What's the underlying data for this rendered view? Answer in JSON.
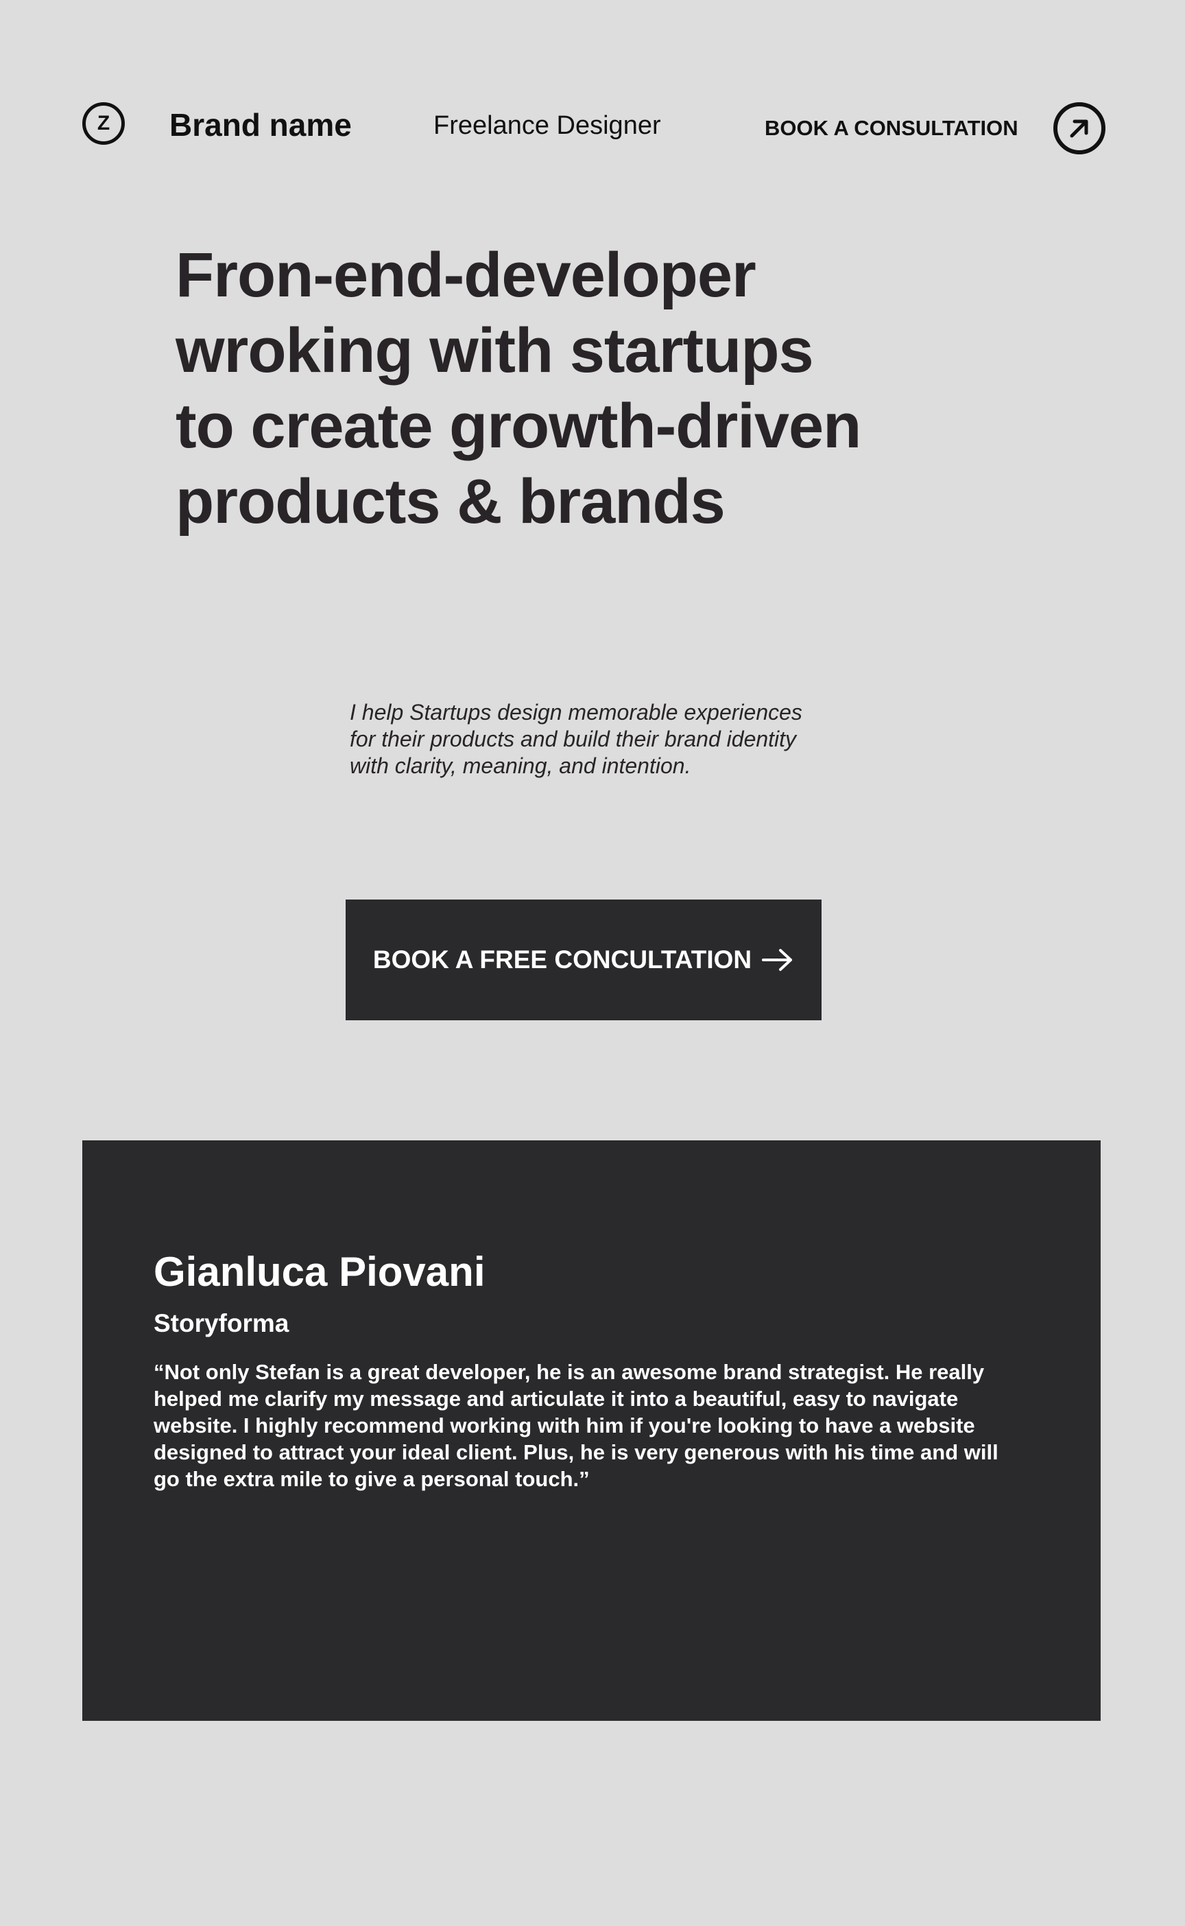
{
  "header": {
    "logo_letter": "Z",
    "brand_name": "Brand name",
    "role": "Freelance Designer",
    "cta_label": "BOOK A CONSULTATION",
    "cta_icon": "arrow-up-right-icon"
  },
  "hero": {
    "title": "Fron-end-developer wroking with startups to create growth-driven products & brands",
    "description": " I help Startups design memorable experiences for their products and build their brand identity with clarity, meaning, and intention.",
    "button_label": "BOOK A FREE CONCULTATION",
    "button_icon": "arrow-right-icon"
  },
  "testimonial": {
    "name": "Gianluca Piovani",
    "company": "Storyforma",
    "quote": "“Not only Stefan is a great developer, he is an awesome brand strategist. He really helped me clarify my message and articulate it into a beautiful, easy to navigate website. I highly recommend working with him if you're looking to have a website designed to attract your ideal client. Plus, he is very generous with his time and will go the extra mile to give a personal touch.”"
  },
  "colors": {
    "background": "#dddddd",
    "text": "#282427",
    "dark_panel": "#2a2a2c",
    "light_text": "#ffffff"
  }
}
